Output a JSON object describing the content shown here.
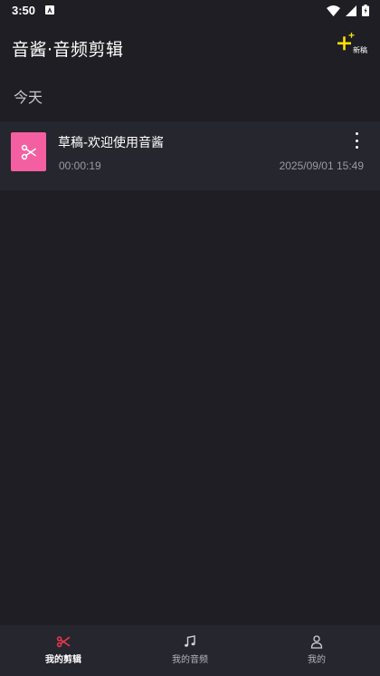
{
  "status_bar": {
    "time": "3:50"
  },
  "app_bar": {
    "title": "音酱·音频剪辑",
    "new_draft_label": "新稿"
  },
  "sections": [
    {
      "header": "今天",
      "items": [
        {
          "title": "草稿-欢迎使用音酱",
          "duration": "00:00:19",
          "date": "2025/09/01 15:49"
        }
      ]
    }
  ],
  "bottom_nav": {
    "items": [
      {
        "label": "我的剪辑",
        "icon": "scissors-icon",
        "active": true
      },
      {
        "label": "我的音频",
        "icon": "music-note-icon",
        "active": false
      },
      {
        "label": "我的",
        "icon": "person-icon",
        "active": false
      }
    ]
  },
  "colors": {
    "background": "#1e1e24",
    "card": "#26262e",
    "accent_pink": "#f45fa1",
    "accent_red": "#e8384f",
    "accent_yellow": "#ffe000"
  }
}
